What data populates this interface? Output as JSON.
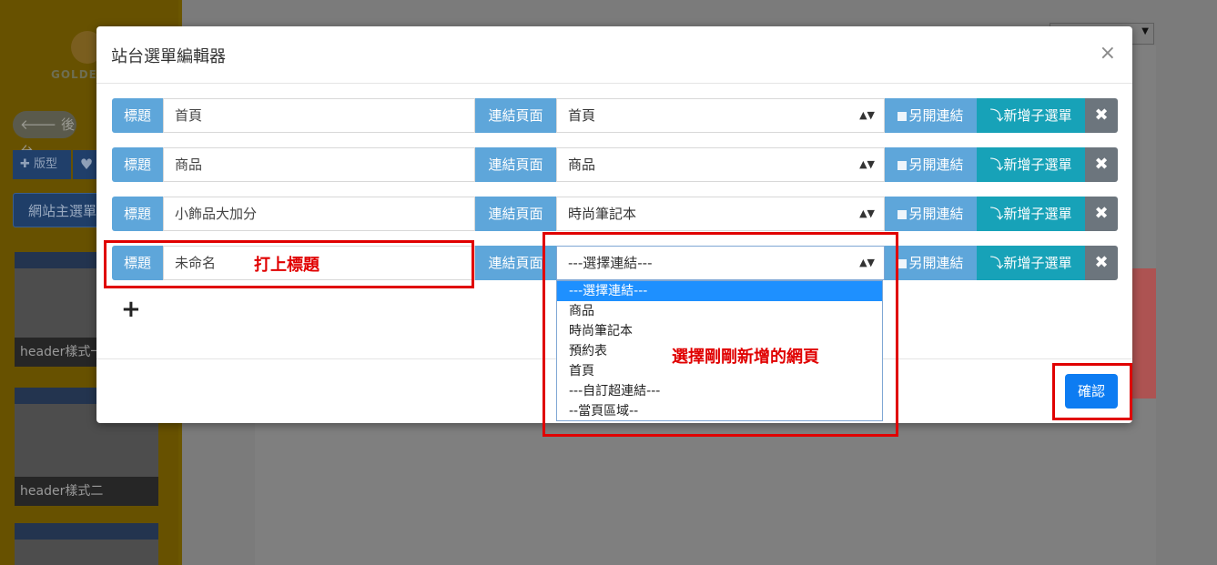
{
  "sidebar": {
    "logo_text": "GOLDEN",
    "back_label": "後台",
    "tab_style_label": "版型",
    "menu_button_label": "網站主選單",
    "thumbnails": [
      {
        "caption": "header樣式一"
      },
      {
        "caption": "header樣式二"
      },
      {
        "caption": ""
      }
    ]
  },
  "modal": {
    "title": "站台選單編輯器",
    "close_label": "×",
    "confirm_label": "確認",
    "add_row_label": "+",
    "rows": [
      {
        "title_label": "標題",
        "title_value": "首頁",
        "link_label": "連結頁面",
        "link_value": "首頁",
        "new_window_label": "另開連結",
        "add_sub_label": "新增子選單",
        "delete_label": "✖"
      },
      {
        "title_label": "標題",
        "title_value": "商品",
        "link_label": "連結頁面",
        "link_value": "商品",
        "new_window_label": "另開連結",
        "add_sub_label": "新增子選單",
        "delete_label": "✖"
      },
      {
        "title_label": "標題",
        "title_value": "小飾品大加分",
        "link_label": "連結頁面",
        "link_value": "時尚筆記本",
        "new_window_label": "另開連結",
        "add_sub_label": "新增子選單",
        "delete_label": "✖"
      },
      {
        "title_label": "標題",
        "title_value": "未命名",
        "link_label": "連結頁面",
        "link_value": "---選擇連結---",
        "new_window_label": "另開連結",
        "add_sub_label": "新增子選單",
        "delete_label": "✖"
      }
    ],
    "dropdown_options": [
      "---選擇連結---",
      "商品",
      "時尚筆記本",
      "預約表",
      "首頁",
      "---自訂超連結---",
      "--當頁區域--"
    ],
    "dropdown_selected_index": 0
  },
  "annotations": {
    "title_note": "打上標題",
    "link_note": "選擇剛剛新增的網頁",
    "highlight_color": "#e00000"
  },
  "colors": {
    "label_blue": "#5ea6da",
    "add_sub_teal": "#17a2b8",
    "delete_gray": "#6c757d",
    "confirm_blue": "#0d7cf2"
  }
}
